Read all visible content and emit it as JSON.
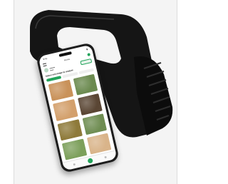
{
  "phone": {
    "status_time": "9:41",
    "app_title": "Home",
    "prompt": "Select soil image to analyze",
    "tab_count": 3,
    "tile_colors": [
      "#c9925a",
      "#6b8a4f",
      "#d3a06c",
      "#5a4634",
      "#8e7a3a",
      "#6f8d52",
      "#7da05c",
      "#d9b48a"
    ]
  },
  "colors": {
    "accent": "#22a35a",
    "device_body": "#111111",
    "background": "#f4f4f4"
  }
}
